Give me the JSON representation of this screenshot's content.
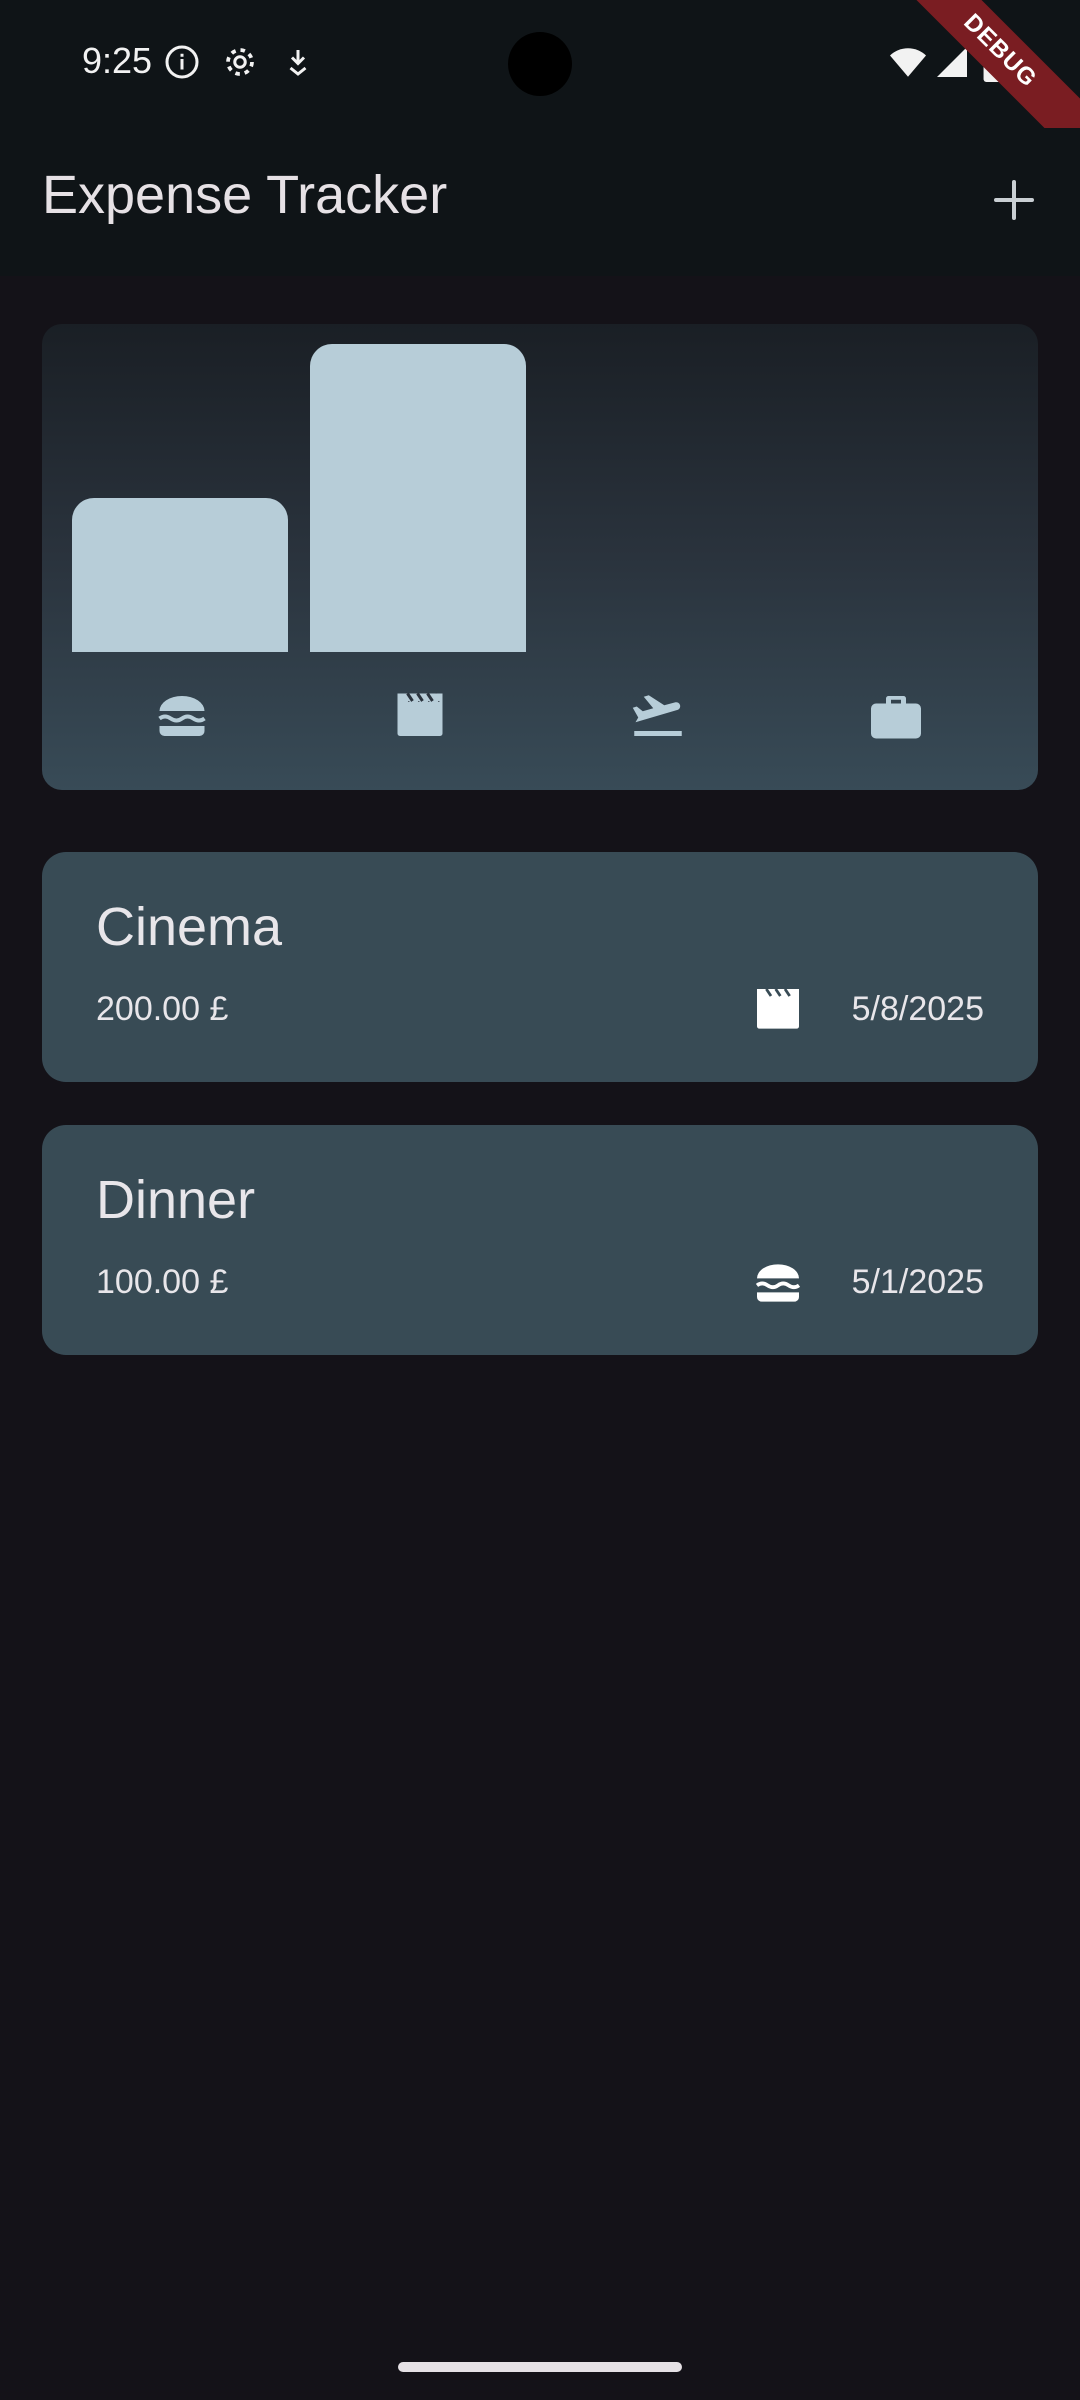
{
  "status_bar": {
    "time": "9:25",
    "icons": [
      "info-icon",
      "settings-gear-icon",
      "download-notification-icon",
      "wifi-icon",
      "cellular-signal-icon",
      "battery-icon"
    ]
  },
  "debug_banner": "DEBUG",
  "app_bar": {
    "title": "Expense Tracker",
    "action_icon": "add-icon"
  },
  "chart_data": {
    "type": "bar",
    "categories": [
      "food",
      "leisure",
      "travel",
      "work"
    ],
    "values": [
      100,
      200,
      0,
      0
    ],
    "ylim": [
      0,
      200
    ],
    "bar_color": "#b7cdd8",
    "category_icons": [
      "hamburger-icon",
      "movie-clapperboard-icon",
      "flight-takeoff-icon",
      "work-briefcase-icon"
    ]
  },
  "expenses": [
    {
      "title": "Cinema",
      "amount": "200.00 £",
      "date": "5/8/2025",
      "icon": "movie-clapperboard-icon"
    },
    {
      "title": "Dinner",
      "amount": "100.00 £",
      "date": "5/1/2025",
      "icon": "hamburger-icon"
    }
  ],
  "colors": {
    "background": "#141218",
    "app_bar": "#0f1417",
    "card": "#384b55",
    "bar": "#b7cdd8",
    "debug_ribbon": "#7a1d22"
  }
}
